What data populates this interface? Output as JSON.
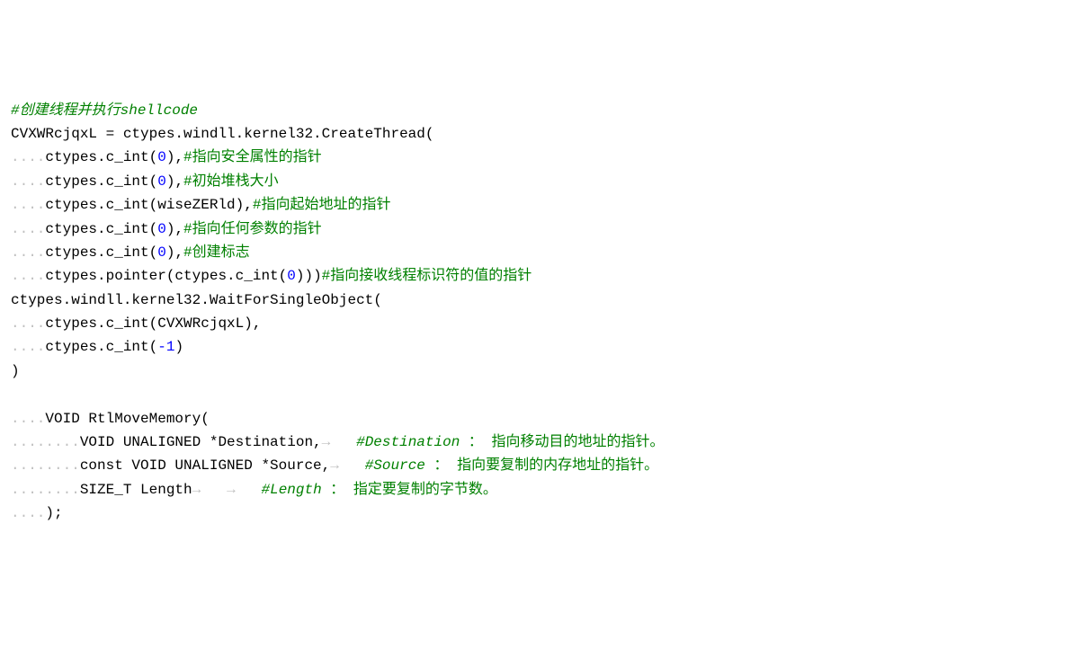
{
  "code": {
    "line1_comment": "#创建线程并执行",
    "line1_shellcode": "shellcode",
    "line2_a": "CVXWRcjqxL = ctypes.windll.kernel32.CreateThread(",
    "ws4": "....",
    "ws8": "........",
    "line3_a": "ctypes.c_int(",
    "line3_num": "0",
    "line3_b": "),",
    "line3_c": "#指向安全属性的指针",
    "line4_a": "ctypes.c_int(",
    "line4_num": "0",
    "line4_b": "),",
    "line4_c": "#初始堆栈大小",
    "line5_a": "ctypes.c_int(wiseZERld),",
    "line5_c": "#指向起始地址的指针",
    "line6_a": "ctypes.c_int(",
    "line6_num": "0",
    "line6_b": "),",
    "line6_c": "#指向任何参数的指针",
    "line7_a": "ctypes.c_int(",
    "line7_num": "0",
    "line7_b": "),",
    "line7_c": "#创建标志",
    "line8_a": "ctypes.pointer(ctypes.c_int(",
    "line8_num": "0",
    "line8_b": ")))",
    "line8_c": "#指向接收线程标识符的值的指针",
    "line9_a": "ctypes.windll.kernel32.WaitForSingleObject(",
    "line10_a": "ctypes.c_int(CVXWRcjqxL),",
    "line11_a": "ctypes.c_int(",
    "line11_num": "-1",
    "line11_b": ")",
    "line12_a": ")",
    "line14_a": "VOID RtlMoveMemory(",
    "line15_a": "VOID UNALIGNED *Destination,",
    "arrow": "→",
    "line15_c_pre": "#",
    "line15_c_name": "Destination",
    "line15_c_post": " ： 指向移动目的地址的指针。",
    "line16_a": "const VOID UNALIGNED *Source,",
    "line16_c_name": "Source",
    "line16_c_post": " ： 指向要复制的内存地址的指针。",
    "line17_a": "SIZE_T Length",
    "line17_c_name": "Length",
    "line17_c_post": " ： 指定要复制的字节数。",
    "line18_a": ");"
  }
}
